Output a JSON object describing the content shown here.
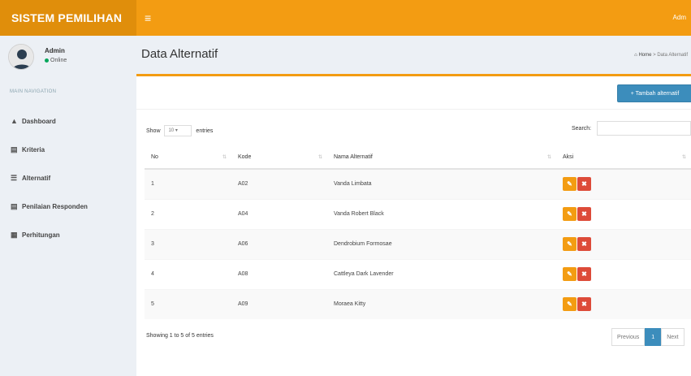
{
  "header": {
    "brand": "SISTEM PEMILIHAN",
    "menu_icon": "≡",
    "user_label": "Adm"
  },
  "sidebar": {
    "user": {
      "name": "Admin",
      "status": "Online"
    },
    "nav_header": "MAIN NAVIGATION",
    "items": [
      {
        "label": "Dashboard",
        "icon": "▲"
      },
      {
        "label": "Kriteria",
        "icon": "▤"
      },
      {
        "label": "Alternatif",
        "icon": "☰"
      },
      {
        "label": "Penilaian Responden",
        "icon": "▤"
      },
      {
        "label": "Perhitungan",
        "icon": "▦"
      }
    ]
  },
  "page": {
    "title": "Data Alternatif",
    "breadcrumb": {
      "home": "Home",
      "separator": ">",
      "current": "Data Alternatif"
    }
  },
  "box": {
    "add_button": "+ Tambah alternatif",
    "show_label": "Show",
    "show_value": "10",
    "entries_label": "entries",
    "search_label": "Search:",
    "search_value": ""
  },
  "table": {
    "columns": [
      "No",
      "Kode",
      "Nama Alternatif",
      "Aksi"
    ],
    "rows": [
      {
        "no": "1",
        "kode": "A02",
        "nama": "Vanda Limbata"
      },
      {
        "no": "2",
        "kode": "A04",
        "nama": "Vanda Robert Black"
      },
      {
        "no": "3",
        "kode": "A06",
        "nama": "Dendrobium Formosae"
      },
      {
        "no": "4",
        "kode": "A08",
        "nama": "Cattleya Dark Lavender"
      },
      {
        "no": "5",
        "kode": "A09",
        "nama": "Moraea Kitty"
      }
    ],
    "edit_icon": "✎",
    "delete_icon": "✖"
  },
  "footer": {
    "info": "Showing 1 to 5 of 5 entries",
    "previous": "Previous",
    "current_page": "1",
    "next": "Next"
  },
  "colors": {
    "header": "#f39c12",
    "brand": "#e08e0b",
    "primary": "#3c8dbc",
    "warning": "#f39c12",
    "danger": "#dd4b39",
    "online": "#00a65a"
  }
}
